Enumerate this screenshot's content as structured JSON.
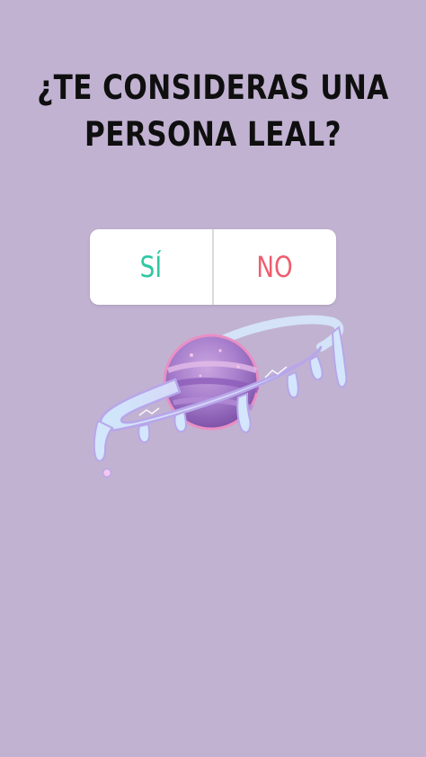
{
  "question": {
    "lines": [
      "¿TE CONSIDERAS UNA",
      "PERSONA LEAL?"
    ]
  },
  "poll": {
    "options": [
      {
        "label": "SÍ",
        "color": "#2fc7a3"
      },
      {
        "label": "NO",
        "color": "#ef5d6e"
      }
    ]
  },
  "sticker": {
    "icon": "planet-sticker-icon"
  },
  "colors": {
    "background": "#c1b2d2",
    "text": "#0f0f0f"
  }
}
